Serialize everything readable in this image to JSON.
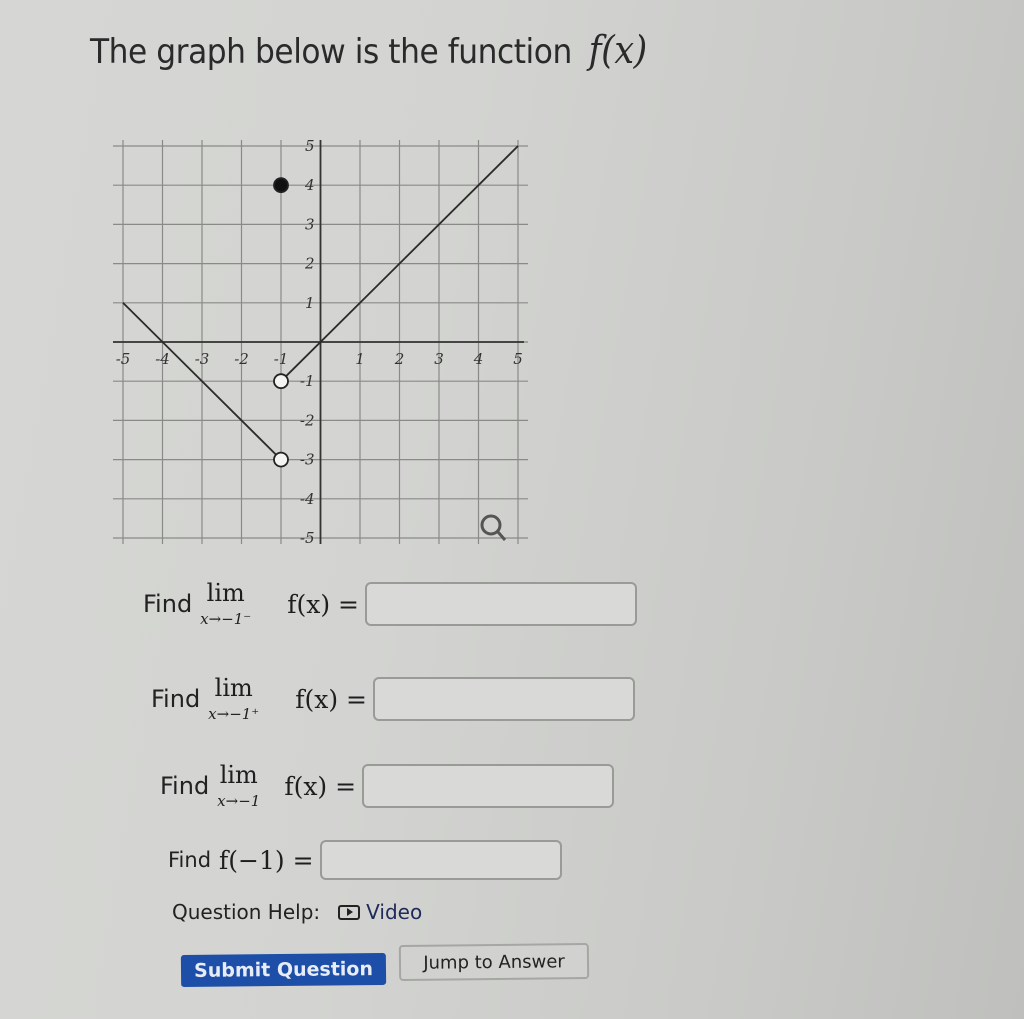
{
  "question": {
    "title_text": "The graph below is the function",
    "title_math": "f(x)"
  },
  "chart_data": {
    "type": "line",
    "title": "",
    "xlabel": "",
    "ylabel": "",
    "xlim": [
      -5,
      5
    ],
    "ylim": [
      -5,
      5
    ],
    "grid": true,
    "x_ticks": [
      "-5",
      "-4",
      "-3",
      "-2",
      "-1",
      "1",
      "2",
      "3",
      "4",
      "5"
    ],
    "y_ticks": [
      "5",
      "4",
      "3",
      "2",
      "1",
      "-1",
      "-2",
      "-3",
      "-4",
      "-5"
    ],
    "x_tick_values": [
      -5,
      -4,
      -3,
      -2,
      -1,
      1,
      2,
      3,
      4,
      5
    ],
    "y_tick_values": [
      5,
      4,
      3,
      2,
      1,
      -1,
      -2,
      -3,
      -4,
      -5
    ],
    "series": [
      {
        "name": "left-segment",
        "points": [
          [
            -5,
            1
          ],
          [
            -1,
            -3
          ]
        ],
        "end_open": true
      },
      {
        "name": "right-segment",
        "points": [
          [
            -1,
            -1
          ],
          [
            5,
            5
          ]
        ],
        "start_open": true
      }
    ],
    "points": [
      {
        "name": "filled-point",
        "x": -1,
        "y": 4,
        "filled": true
      },
      {
        "name": "open-circle-upper",
        "x": -1,
        "y": -1,
        "filled": false
      },
      {
        "name": "open-circle-lower",
        "x": -1,
        "y": -3,
        "filled": false
      }
    ],
    "tool_icon": "magnifier-icon"
  },
  "parts": [
    {
      "find": "Find",
      "lim": "lim",
      "sub": "x→−1⁻",
      "expr": "f(x) =",
      "value": ""
    },
    {
      "find": "Find",
      "lim": "lim",
      "sub": "x→−1⁺",
      "expr": "f(x) =",
      "value": ""
    },
    {
      "find": "Find",
      "lim": "lim",
      "sub": "x→−1",
      "expr": "f(x) =",
      "value": ""
    },
    {
      "find": "Find",
      "expr": "f(−1) =",
      "value": ""
    }
  ],
  "help": {
    "label": "Question Help:",
    "video_label": "Video",
    "video_icon": "play-video-icon"
  },
  "buttons": {
    "submit": "Submit Question",
    "jump": "Jump to Answer"
  },
  "colors": {
    "submit_bg": "#1e4fa8",
    "page_bg": "#d3d4d1"
  }
}
